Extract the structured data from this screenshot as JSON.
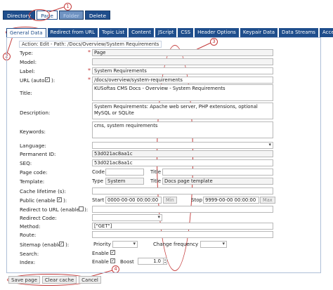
{
  "toolbar": {
    "items": [
      {
        "label": "Directory"
      },
      {
        "label": "Page"
      },
      {
        "label": "Folder"
      },
      {
        "label": "Delete"
      }
    ]
  },
  "callouts": [
    "1",
    "2",
    "3",
    "4"
  ],
  "tabs": [
    {
      "label": "General Data"
    },
    {
      "label": "Redirect from URL"
    },
    {
      "label": "Topic List"
    },
    {
      "label": "Content"
    },
    {
      "label": "JScript"
    },
    {
      "label": "CSS"
    },
    {
      "label": "Header Options"
    },
    {
      "label": "Keypair Data"
    },
    {
      "label": "Data Streams"
    },
    {
      "label": "Access"
    }
  ],
  "path": "Action: Edit - Path: /Docs/Overview/System Requirements",
  "labels": {
    "type": "Type:",
    "model": "Model:",
    "label": "Label:",
    "url": "URL (auto",
    "url_suffix": "):",
    "title": "Title:",
    "description": "Description:",
    "keywords": "Keywords:",
    "language": "Language:",
    "permanent_id": "Permanent ID:",
    "seq": "SEQ:",
    "page_code": "Page code:",
    "template": "Template:",
    "cache_lifetime": "Cache lifetime (s):",
    "public": "Public (enable",
    "public_suffix": "):",
    "redirect_url": "Redirect to URL (enable",
    "redirect_url_suffix": "):",
    "redirect_code": "Redirect Code:",
    "method": "Method:",
    "route": "Route:",
    "sitemap": "Sitemap (enable",
    "sitemap_suffix": "):",
    "search": "Search:",
    "index": "Index:"
  },
  "values": {
    "type": "Page",
    "model": "",
    "label": "System Requirements",
    "url": "/docs/overview/system-requirements",
    "title": "KUSoftas CMS Docs - Overview - System Requirements",
    "description": "System Requirements: Apache web server, PHP extensions, optional MySQL or SQLite",
    "keywords": "cms, system requirements",
    "language": "",
    "permanent_id": "53d021ac8aa1c",
    "seq": "53d021ac8aa1c",
    "page_code": "",
    "page_title": "",
    "template_type": "System",
    "template_title": "Docs page template",
    "cache_lifetime": "",
    "public_start": "0000-00-00 00:00:00",
    "public_stop": "9999-00-00 00:00:00",
    "redirect_url": "",
    "redirect_code": "",
    "method": "[\"GET\"]",
    "route": "",
    "boost": "1.0"
  },
  "inline": {
    "code": "Code",
    "title": "Title",
    "type": "Type",
    "start": "Start",
    "min": "Min",
    "stop": "Stop",
    "max": "Max",
    "priority": "Priority",
    "change_frequency": "Change frequency",
    "enable": "Enable",
    "boost": "Boost"
  },
  "checkbox_mark": "✓",
  "footer": {
    "save": "Save page",
    "clear": "Clear cache",
    "cancel": "Cancel"
  },
  "colors": {
    "accent": "#1f4e8c",
    "callout": "#c43a3a"
  }
}
